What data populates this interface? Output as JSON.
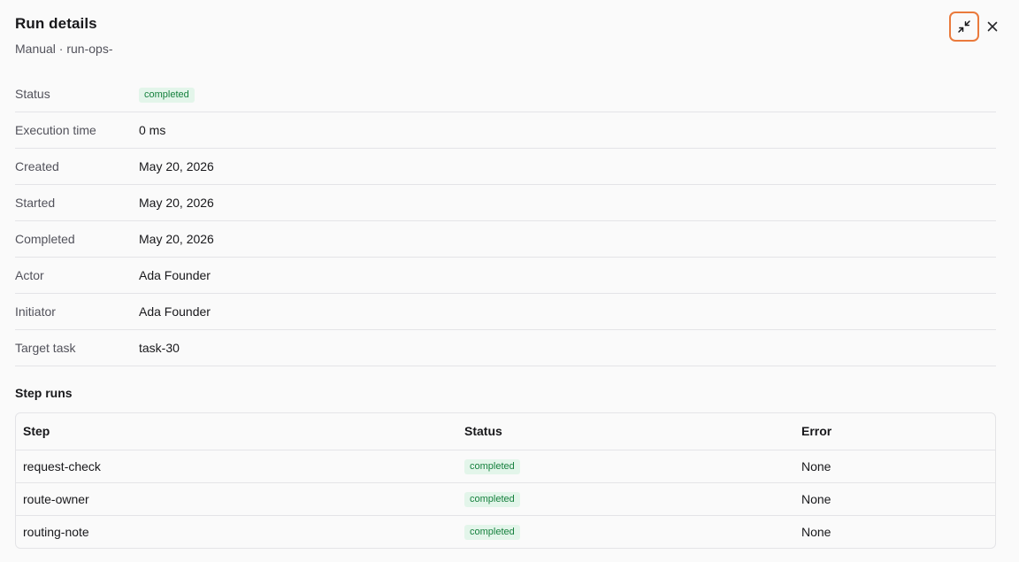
{
  "header": {
    "title": "Run details",
    "subtitle": "Manual · run-ops-"
  },
  "icons": {
    "collapse": "collapse-arrows-icon",
    "close": "close-icon"
  },
  "colors": {
    "accent_focus": "#ea7a3c",
    "badge_bg": "#e3f5ea",
    "badge_text": "#15803d"
  },
  "details": [
    {
      "label": "Status",
      "value": "completed",
      "type": "badge"
    },
    {
      "label": "Execution time",
      "value": "0 ms"
    },
    {
      "label": "Created",
      "value": "May 20, 2026"
    },
    {
      "label": "Started",
      "value": "May 20, 2026"
    },
    {
      "label": "Completed",
      "value": "May 20, 2026"
    },
    {
      "label": "Actor",
      "value": "Ada Founder"
    },
    {
      "label": "Initiator",
      "value": "Ada Founder"
    },
    {
      "label": "Target task",
      "value": "task-30"
    }
  ],
  "step_runs": {
    "title": "Step runs",
    "columns": [
      "Step",
      "Status",
      "Error"
    ],
    "rows": [
      {
        "step": "request-check",
        "status": "completed",
        "error": "None"
      },
      {
        "step": "route-owner",
        "status": "completed",
        "error": "None"
      },
      {
        "step": "routing-note",
        "status": "completed",
        "error": "None"
      }
    ]
  }
}
